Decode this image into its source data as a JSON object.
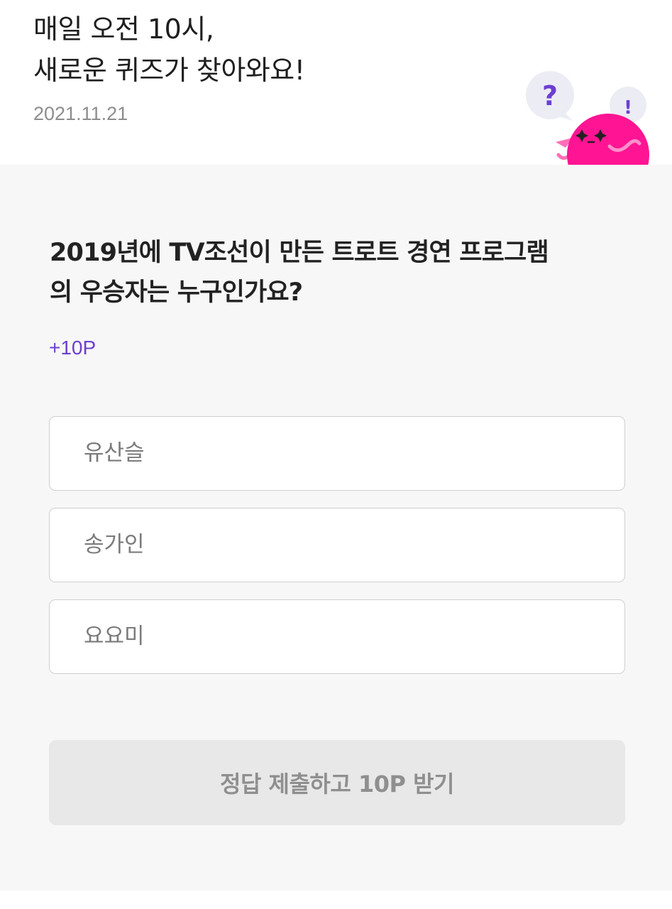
{
  "header": {
    "title_line1": "매일 오전 10시,",
    "title_line2": "새로운 퀴즈가 찾아와요!",
    "date": "2021.11.21"
  },
  "mascot": {
    "question_mark": "?",
    "exclamation_mark": "!",
    "icon": "pink-ball-mascot-icon"
  },
  "quiz": {
    "question_line1": "2019년에 TV조선이 만든 트로트 경연 프로그램",
    "question_line2": "의 우승자는 누구인가요?",
    "points": "+10P",
    "options": [
      {
        "label": "유산슬"
      },
      {
        "label": "송가인"
      },
      {
        "label": "요요미"
      }
    ],
    "submit_label": "정답 제출하고 10P 받기"
  },
  "colors": {
    "accent": "#6c3fd1",
    "mascot_pink": "#ff1493",
    "panel_bg": "#f7f7f7",
    "button_disabled_bg": "#e8e8e8"
  }
}
